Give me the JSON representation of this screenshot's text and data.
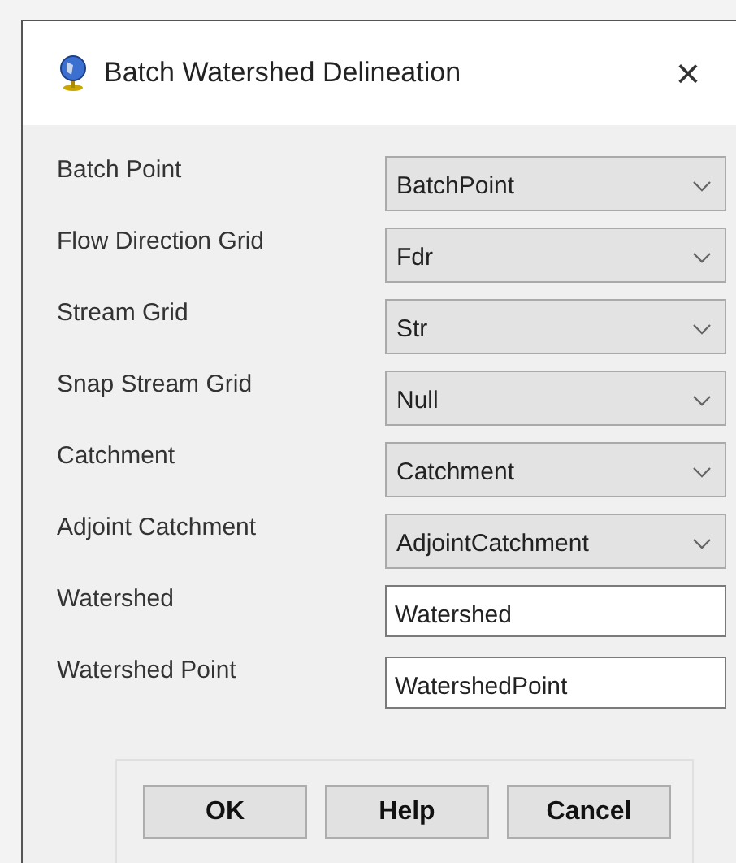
{
  "window": {
    "title": "Batch Watershed Delineation",
    "close": "×"
  },
  "fields": [
    {
      "label": "Batch Point",
      "kind": "dropdown",
      "value": "BatchPoint"
    },
    {
      "label": "Flow Direction Grid",
      "kind": "dropdown",
      "value": "Fdr"
    },
    {
      "label": "Stream Grid",
      "kind": "dropdown",
      "value": "Str"
    },
    {
      "label": "Snap Stream Grid",
      "kind": "dropdown",
      "value": "Null"
    },
    {
      "label": "Catchment",
      "kind": "dropdown",
      "value": "Catchment"
    },
    {
      "label": "Adjoint Catchment",
      "kind": "dropdown",
      "value": "AdjointCatchment"
    },
    {
      "label": "Watershed",
      "kind": "text",
      "value": "Watershed"
    },
    {
      "label": "Watershed Point",
      "kind": "text",
      "value": "WatershedPoint"
    }
  ],
  "buttons": [
    "OK",
    "Help",
    "Cancel"
  ]
}
